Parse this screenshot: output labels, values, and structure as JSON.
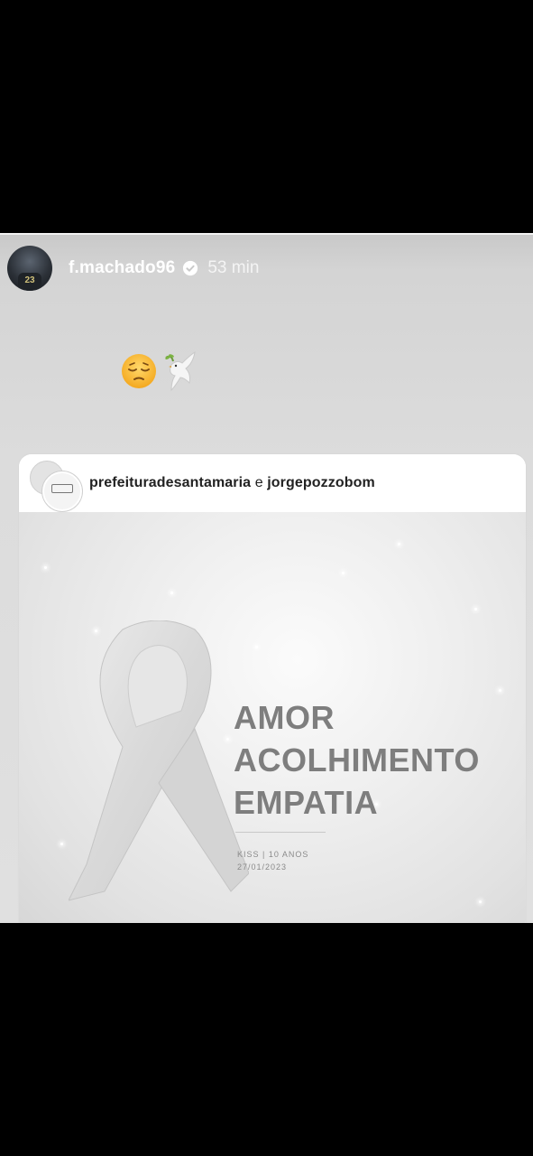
{
  "story": {
    "username": "f.machado96",
    "time": "53 min",
    "avatar_jersey_number": "23",
    "emojis": [
      "pensive-face",
      "dove-of-peace"
    ]
  },
  "shared_post": {
    "account_primary": "prefeituradesantamaria",
    "connector": "e",
    "account_secondary": "jorgepozzobom",
    "poster": {
      "words": [
        "AMOR",
        "ACOLHIMENTO",
        "EMPATIA"
      ],
      "footnote_line1": "KISS | 10 ANOS",
      "footnote_line2": "27/01/2023"
    }
  },
  "colors": {
    "story_background": "#d8d8d8",
    "poster_text": "#7e7e7e",
    "page_background": "#000000"
  }
}
